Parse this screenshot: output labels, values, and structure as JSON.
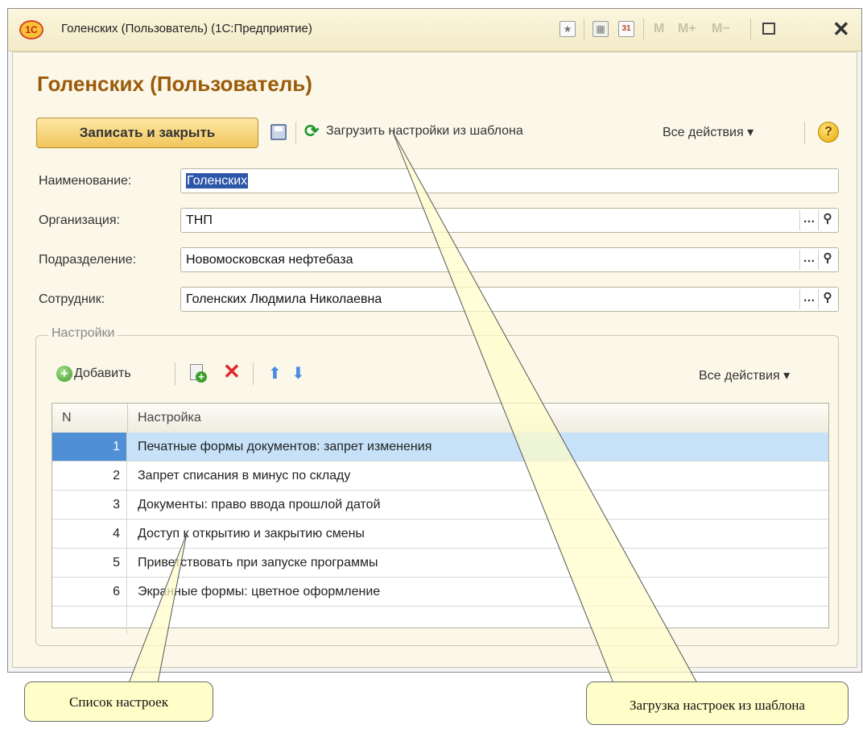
{
  "window": {
    "title": "Голенских (Пользователь)  (1С:Предприятие)",
    "logo_text": "1С",
    "toolbar_icons": [
      "favorite-icon",
      "calculator-icon",
      "calendar-icon"
    ],
    "calendar_day": "31",
    "memory_buttons": [
      "M",
      "M+",
      "M−"
    ]
  },
  "form": {
    "heading": "Голенских (Пользователь)",
    "save_close_label": "Записать и закрыть",
    "load_template_label": "Загрузить настройки из шаблона",
    "all_actions_label": "Все действия ▾",
    "help_label": "?"
  },
  "fields": [
    {
      "label": "Наименование:",
      "value": "Голенских",
      "selected": true
    },
    {
      "label": "Организация:",
      "value": "ТНП"
    },
    {
      "label": "Подразделение:",
      "value": "Новомосковская нефтебаза"
    },
    {
      "label": "Сотрудник:",
      "value": "Голенских Людмила Николаевна"
    }
  ],
  "settings": {
    "group_title": "Настройки",
    "add_label": "Добавить",
    "all_actions_label": "Все действия ▾",
    "columns": [
      "N",
      "Настройка"
    ],
    "rows": [
      {
        "n": "1",
        "text": "Печатные формы документов: запрет изменения",
        "selected": true
      },
      {
        "n": "2",
        "text": "Запрет списания в минус по складу"
      },
      {
        "n": "3",
        "text": "Документы: право ввода прошлой датой"
      },
      {
        "n": "4",
        "text": "Доступ к открытию и закрытию смены"
      },
      {
        "n": "5",
        "text": "Приветствовать при запуске программы"
      },
      {
        "n": "6",
        "text": "Экранные формы: цветное оформление"
      }
    ]
  },
  "callouts": {
    "list_label": "Список настроек",
    "load_label": "Загрузка настроек из шаблона"
  },
  "colors": {
    "heading": "#9b5b09",
    "primary_button": "#f1c55a",
    "selected_row": "#c7e2f8",
    "selected_row_number": "#4f8fd6",
    "callout_fill": "#fffec8"
  }
}
